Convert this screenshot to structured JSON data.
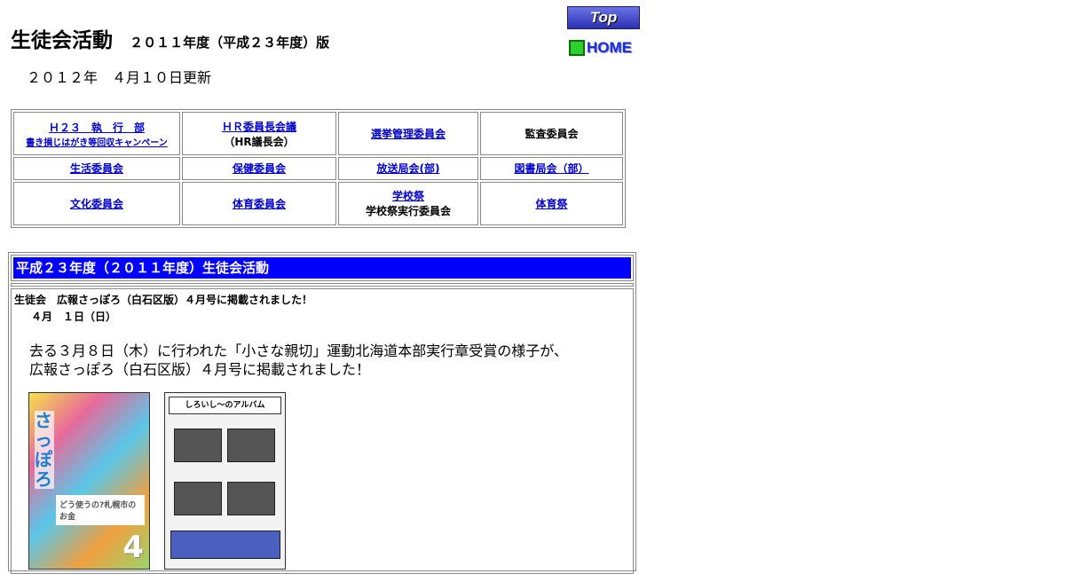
{
  "header": {
    "title": "生徒会活動",
    "subtitle": "２０１１年度（平成２３年度）版",
    "updated": "２０１２年　４月１０日更新",
    "top_button": "Top",
    "home_button": "HOME"
  },
  "nav": {
    "rows": [
      [
        {
          "label": "Ｈ２３　執　行　部",
          "sub": "書き損じはがき等回収キャンペーン"
        },
        {
          "label": "ＨＲ委員長会議",
          "sub": "（HR議長会）"
        },
        {
          "label": "選挙管理委員会"
        },
        {
          "label": "監査委員会"
        }
      ],
      [
        {
          "label": "生活委員会"
        },
        {
          "label": "保健委員会"
        },
        {
          "label": "放送局会(部)"
        },
        {
          "label": "図書局会（部）"
        }
      ],
      [
        {
          "label": "文化委員会"
        },
        {
          "label": "体育委員会"
        },
        {
          "label": "学校祭",
          "sub": "学校祭実行委員会"
        },
        {
          "label": "体育祭"
        }
      ]
    ]
  },
  "news": {
    "heading": "平成２３年度（２０１１年度）生徒会活動",
    "item": {
      "title": "生徒会　広報さっぽろ（白石区版）４月号に掲載されました！",
      "date": "４月　１日（日）",
      "text1": "去る３月８日（木）に行われた「小さな親切」運動北海道本部実行章受賞の様子が、",
      "text2": "広報さっぽろ（白石区版）４月号に掲載されました！"
    },
    "magazine": {
      "title": "さっぽろ",
      "label": "どう使うの?札幌市のお金",
      "issue": "4"
    },
    "album": {
      "title": "しろいし〜のアルバム"
    }
  }
}
